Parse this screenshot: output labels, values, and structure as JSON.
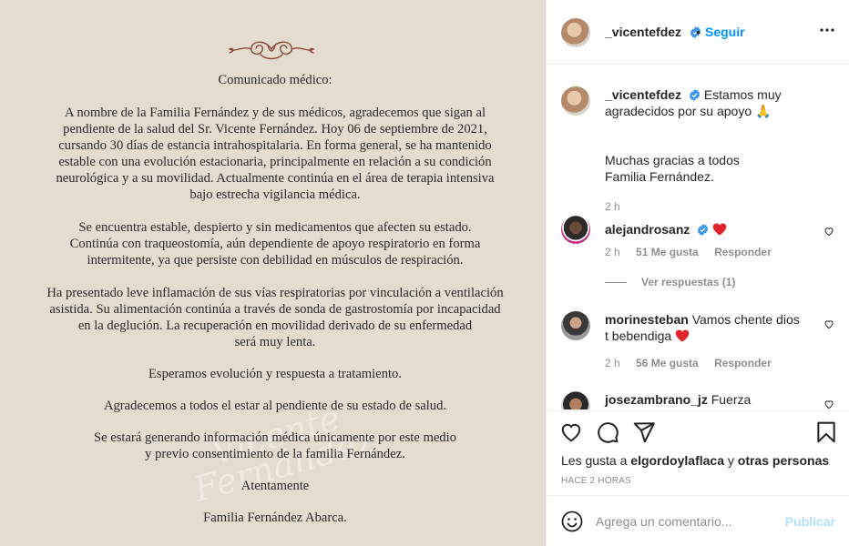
{
  "image": {
    "letter": {
      "title": "Comunicado médico:",
      "p1": "A nombre de la Familia Fernández y de sus médicos, agradecemos que sigan al\npendiente de la salud del Sr. Vicente Fernández. Hoy 06 de septiembre de 2021,\ncursando 30 días de estancia intrahospitalaria.  En forma general, se ha mantenido\nestable con una evolución estacionaria, principalmente en relación a su condición\nneurológica y a su movilidad. Actualmente continúa en el área de terapia intensiva\nbajo estrecha vigilancia médica.",
      "p2": "Se encuentra estable, despierto y sin medicamentos que afecten su estado.\nContinúa con traqueostomía, aún dependiente de apoyo respiratorio en forma\nintermitente, ya que persiste con debilidad en músculos de respiración.",
      "p3": "Ha presentado leve inflamación de sus vías respiratorias por vinculación a ventilación\nasistida. Su alimentación continúa a través de sonda de gastrostomía por incapacidad\nen la deglución. La recuperación en movilidad derivado de su enfermedad\nserá muy lenta.",
      "p4": "Esperamos evolución y respuesta a tratamiento.",
      "p5": "Agradecemos a todos el estar al pendiente de su estado de salud.",
      "p6": "Se estará generando información médica únicamente por este medio\ny previo consentimiento de la familia Fernández.",
      "closing": "Atentamente",
      "signature": "Familia Fernández Abarca."
    },
    "watermark_text": "Vicente Fernández"
  },
  "header": {
    "username": "_vicentefdez",
    "separator": "•",
    "follow_label": "Seguir",
    "more_icon": "more-options-icon"
  },
  "caption": {
    "username": "_vicentefdez",
    "text": "Estamos muy agradecidos por su apoyo 🙏",
    "text2": "Muchas gracias a todos\nFamilia Fernández.",
    "time": "2 h"
  },
  "comments": [
    {
      "username": "alejandrosanz",
      "verified": true,
      "text": "",
      "has_heart_emoji": true,
      "time": "2 h",
      "likes": "51 Me gusta",
      "reply": "Responder",
      "view_replies": "Ver respuestas (1)"
    },
    {
      "username": "morinesteban",
      "verified": false,
      "text": "Vamos chente dios t bebendiga",
      "has_heart_emoji": true,
      "time": "2 h",
      "likes": "56 Me gusta",
      "reply": "Responder"
    },
    {
      "username": "josezambrano_jz",
      "verified": false,
      "text": "Fuerza"
    }
  ],
  "actions": {
    "likes_prefix": "Les gusta a",
    "likes_user": "elgordoylaflaca",
    "likes_mid": "y",
    "likes_suffix": "otras personas",
    "time_ago": "HACE 2 HORAS"
  },
  "add_comment": {
    "placeholder": "Agrega un comentario...",
    "post_label": "Publicar"
  },
  "colors": {
    "accent": "#0095f6",
    "verified": "#3897f0",
    "heart": "#ed4956",
    "image_bg": "#e4dccf"
  }
}
